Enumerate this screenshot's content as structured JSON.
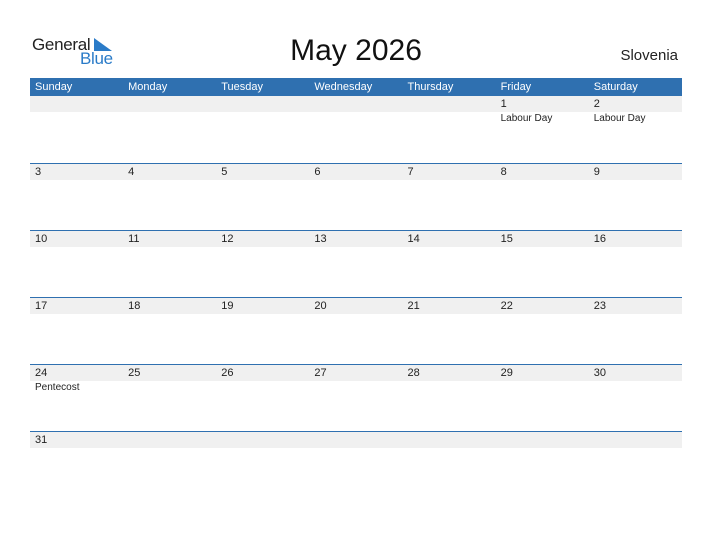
{
  "logo": {
    "general": "General",
    "blue": "Blue"
  },
  "title": "May 2026",
  "country": "Slovenia",
  "weekdays": [
    "Sunday",
    "Monday",
    "Tuesday",
    "Wednesday",
    "Thursday",
    "Friday",
    "Saturday"
  ],
  "weeks": [
    [
      {
        "d": "",
        "e": ""
      },
      {
        "d": "",
        "e": ""
      },
      {
        "d": "",
        "e": ""
      },
      {
        "d": "",
        "e": ""
      },
      {
        "d": "",
        "e": ""
      },
      {
        "d": "1",
        "e": "Labour Day"
      },
      {
        "d": "2",
        "e": "Labour Day"
      }
    ],
    [
      {
        "d": "3",
        "e": ""
      },
      {
        "d": "4",
        "e": ""
      },
      {
        "d": "5",
        "e": ""
      },
      {
        "d": "6",
        "e": ""
      },
      {
        "d": "7",
        "e": ""
      },
      {
        "d": "8",
        "e": ""
      },
      {
        "d": "9",
        "e": ""
      }
    ],
    [
      {
        "d": "10",
        "e": ""
      },
      {
        "d": "11",
        "e": ""
      },
      {
        "d": "12",
        "e": ""
      },
      {
        "d": "13",
        "e": ""
      },
      {
        "d": "14",
        "e": ""
      },
      {
        "d": "15",
        "e": ""
      },
      {
        "d": "16",
        "e": ""
      }
    ],
    [
      {
        "d": "17",
        "e": ""
      },
      {
        "d": "18",
        "e": ""
      },
      {
        "d": "19",
        "e": ""
      },
      {
        "d": "20",
        "e": ""
      },
      {
        "d": "21",
        "e": ""
      },
      {
        "d": "22",
        "e": ""
      },
      {
        "d": "23",
        "e": ""
      }
    ],
    [
      {
        "d": "24",
        "e": "Pentecost"
      },
      {
        "d": "25",
        "e": ""
      },
      {
        "d": "26",
        "e": ""
      },
      {
        "d": "27",
        "e": ""
      },
      {
        "d": "28",
        "e": ""
      },
      {
        "d": "29",
        "e": ""
      },
      {
        "d": "30",
        "e": ""
      }
    ],
    [
      {
        "d": "31",
        "e": ""
      },
      {
        "d": "",
        "e": ""
      },
      {
        "d": "",
        "e": ""
      },
      {
        "d": "",
        "e": ""
      },
      {
        "d": "",
        "e": ""
      },
      {
        "d": "",
        "e": ""
      },
      {
        "d": "",
        "e": ""
      }
    ]
  ],
  "colors": {
    "header": "#2f70b0",
    "brand_blue": "#2a7bc8",
    "band": "#f0f0f0"
  }
}
